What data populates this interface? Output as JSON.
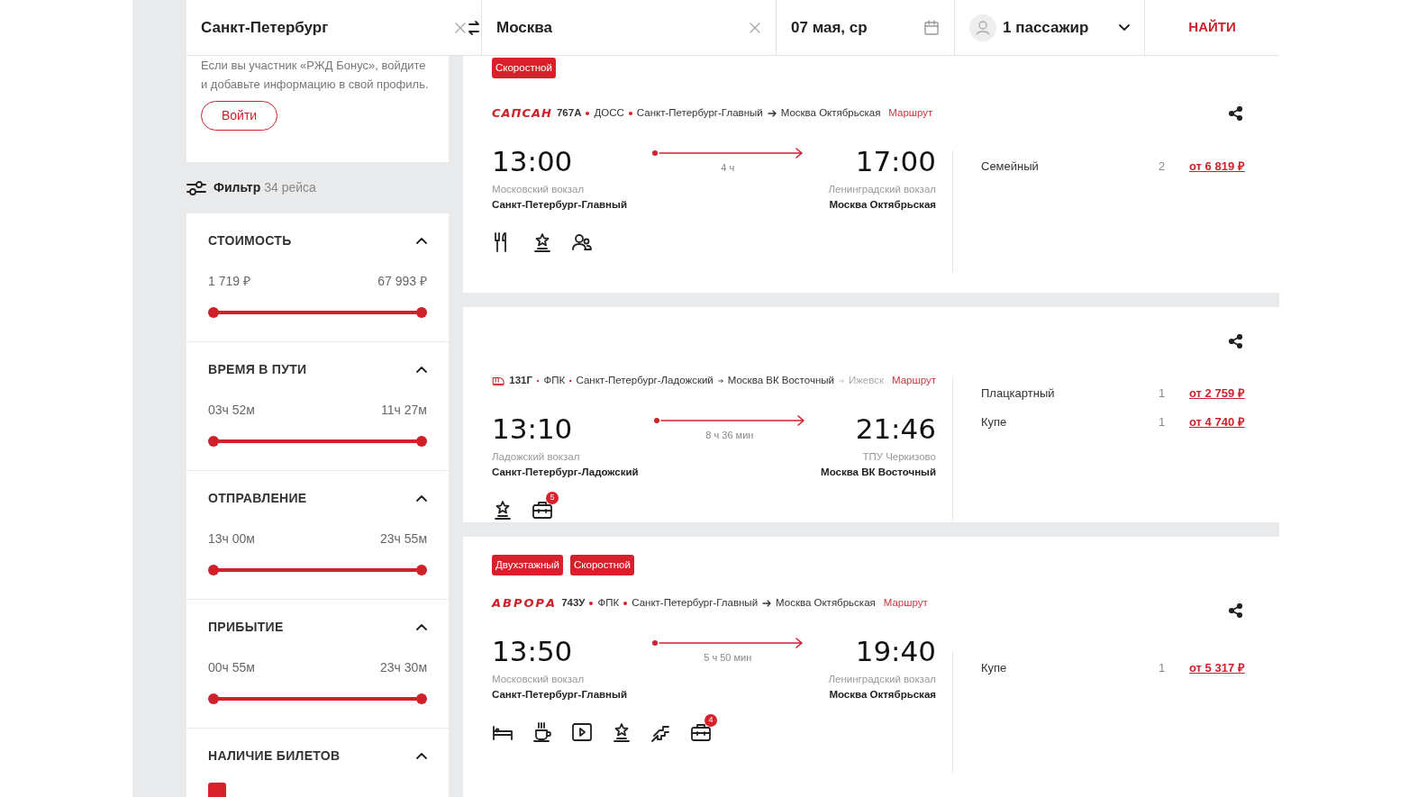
{
  "search": {
    "from": "Санкт-Петербург",
    "to": "Москва",
    "date": "07 мая, ср",
    "passengers": "1 пассажир",
    "find_button": "НАЙТИ"
  },
  "sidebar": {
    "bonus_text": "Если вы участник «РЖД Бонус», войдите и добавьте информацию в свой профиль.",
    "login_button": "Войти",
    "filter": {
      "label": "Фильтр",
      "count": "34 рейса"
    },
    "sections": [
      {
        "kind": "range",
        "title": "СТОИМОСТЬ",
        "expanded": true,
        "min_label": "1 719 ₽",
        "max_label": "67 993 ₽",
        "thumbs": [
          {
            "level": 0
          },
          {
            "level": 1
          }
        ]
      },
      {
        "kind": "range",
        "title": "ВРЕМЯ В ПУТИ",
        "expanded": true,
        "min_label": "03ч 52м",
        "max_label": "11ч 27м",
        "thumbs": [
          {
            "level": 0
          },
          {
            "level": 1
          }
        ]
      },
      {
        "kind": "range",
        "title": "ОТПРАВЛЕНИЕ",
        "expanded": true,
        "min_label": "13ч 00м",
        "max_label": "23ч 55м",
        "thumbs": [
          {
            "level": 0
          },
          {
            "level": 1
          }
        ]
      },
      {
        "kind": "range",
        "title": "ПРИБЫТИЕ",
        "expanded": true,
        "min_label": "00ч 55м",
        "max_label": "23ч 30м",
        "thumbs": [
          {
            "level": 0
          },
          {
            "level": 1
          }
        ]
      },
      {
        "kind": "checks",
        "title": "НАЛИЧИЕ БИЛЕТОВ",
        "expanded": true,
        "items": [
          {
            "checked": true
          }
        ]
      }
    ]
  },
  "trains": [
    {
      "tags": [
        "Скоростной"
      ],
      "logo": {
        "kind": "sapsan",
        "text": "САПСАН"
      },
      "number": "767А",
      "carrier": "ДОСС",
      "from_station": "Санкт-Петербург-Главный",
      "to_station": "Москва Октябрьская",
      "route_link": "Маршрут",
      "dep_time": "13:00",
      "duration": "4 ч",
      "arr_time": "17:00",
      "dep_note": "Московский вокзал",
      "dep_station": "Санкт-Петербург-Главный",
      "arr_note": "Ленинградский вокзал",
      "arr_station": "Москва Октябрьская",
      "amenities": [
        {
          "kind": "restaurant"
        },
        {
          "kind": "star"
        },
        {
          "kind": "people"
        }
      ],
      "fares": [
        {
          "class": "Семейный",
          "seats": "2",
          "price": "от 6 819 ₽"
        }
      ]
    },
    {
      "logo": {
        "kind": "train"
      },
      "number": "131Г",
      "carrier": "ФПК",
      "from_station": "Санкт-Петербург-Ладожский",
      "to_station": "Москва ВК Восточный",
      "final_station": "Ижевск",
      "route_link": "Маршрут",
      "dep_time": "13:10",
      "duration": "8 ч 36 мин",
      "arr_time": "21:46",
      "dep_note": "Ладожский вокзал",
      "dep_station": "Санкт-Петербург-Ладожский",
      "arr_note": "ТПУ Черкизово",
      "arr_station": "Москва ВК Восточный",
      "amenities": [
        {
          "kind": "star"
        },
        {
          "kind": "luggage",
          "badge": "5"
        }
      ],
      "fares": [
        {
          "class": "Плацкартный",
          "seats": "1",
          "price": "от 2 759 ₽"
        },
        {
          "class": "Купе",
          "seats": "1",
          "price": "от 4 740 ₽"
        }
      ]
    },
    {
      "tags": [
        "Двухэтажный",
        "Скоростной"
      ],
      "logo": {
        "kind": "avrora",
        "text": "АВРОРА"
      },
      "number": "743У",
      "carrier": "ФПК",
      "from_station": "Санкт-Петербург-Главный",
      "to_station": "Москва Октябрьская",
      "route_link": "Маршрут",
      "dep_time": "13:50",
      "duration": "5 ч 50 мин",
      "arr_time": "19:40",
      "dep_note": "Московский вокзал",
      "dep_station": "Санкт-Петербург-Главный",
      "arr_note": "Ленинградский вокзал",
      "arr_station": "Москва Октябрьская",
      "amenities": [
        {
          "kind": "bed"
        },
        {
          "kind": "coffee"
        },
        {
          "kind": "video"
        },
        {
          "kind": "star"
        },
        {
          "kind": "stairs"
        },
        {
          "kind": "luggage",
          "badge": "4"
        }
      ],
      "fares": [
        {
          "class": "Купе",
          "seats": "1",
          "price": "от 5 317 ₽"
        }
      ]
    }
  ]
}
